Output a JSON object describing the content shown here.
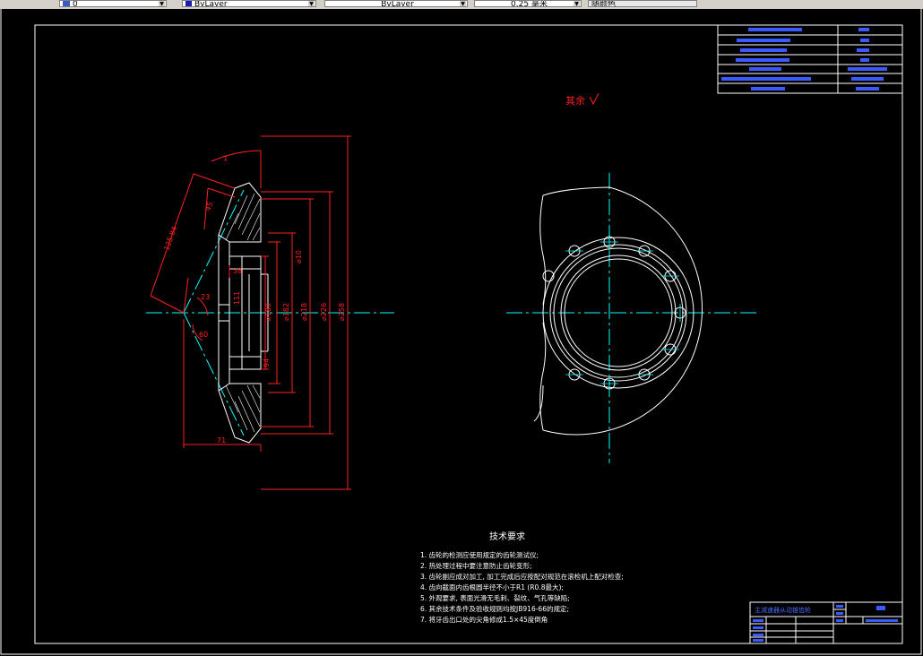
{
  "toolbar": {
    "layer_icon": "layer-icon",
    "layer_value": "0",
    "color_value": "ByLayer",
    "linetype_value": "ByLayer",
    "lineweight_value": "0.25 毫米",
    "plotstyle_value": "随颜色"
  },
  "drawing": {
    "remaining_label": "其余",
    "tech_title": "技术要求",
    "tech_items": [
      "1. 齿轮的检测应使用规定的齿轮测试仪;",
      "2. 热处理过程中要注意防止齿轮变形;",
      "3. 齿轮副应成对加工, 加工完成后应按配对规范在滚检机上配对检查;",
      "4. 齿向截面内齿根圆半径不小于R1 (R0.8最大);",
      "5. 外观要求, 表面光滑无毛刺、裂纹、气孔等缺陷;",
      "6. 其余技术条件及验收规则均按JB916-66的规定;",
      "7. 将牙齿出口处的尖角修成1.5×45度倒角"
    ],
    "title_block_name": "主减速器从动锥齿轮",
    "dims": {
      "d1": "2",
      "angle": "23",
      "a1": "125.84",
      "r1": "45",
      "f1": "38",
      "f2": "111",
      "f3": "94",
      "d180": "⌀180",
      "d182": "⌀182",
      "d218": "⌀218",
      "d226": "⌀226",
      "d258": "⌀258",
      "d8": "⌀10",
      "w": "71",
      "d25": "25",
      "a60": "60"
    }
  }
}
